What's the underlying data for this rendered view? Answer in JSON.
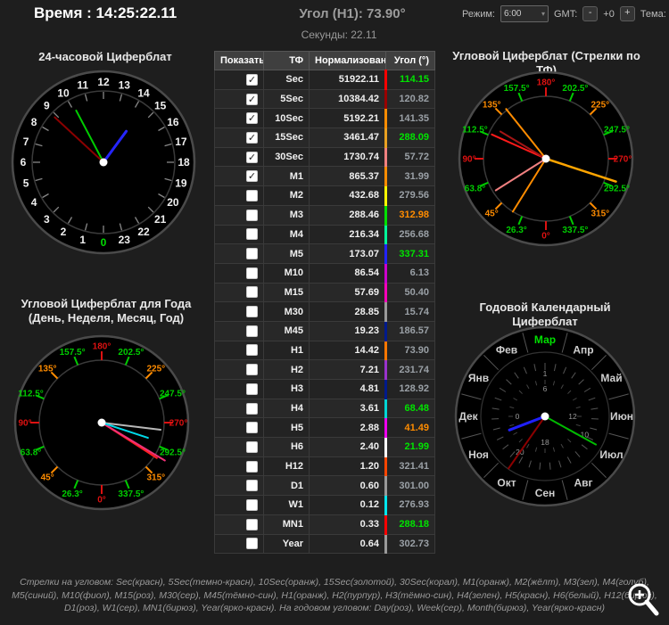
{
  "header": {
    "time_label": "Время : 14:25:22.11",
    "angle_label": "Угол (H1): 73.90°",
    "seconds_label": "Секунды: 22.11",
    "mode_label": "Режим:",
    "mode_value": "6:00",
    "gmt_label": "GMT:",
    "gmt_minus": "-",
    "gmt_offset": "+0",
    "gmt_plus": "+",
    "theme_label": "Тема:"
  },
  "clock24": {
    "title": "24-часовой Циферблат",
    "numbers": [
      {
        "t": "12",
        "phi": 0
      },
      {
        "t": "13",
        "phi": 15
      },
      {
        "t": "14",
        "phi": 30
      },
      {
        "t": "15",
        "phi": 45
      },
      {
        "t": "16",
        "phi": 60
      },
      {
        "t": "17",
        "phi": 75
      },
      {
        "t": "18",
        "phi": 90
      },
      {
        "t": "19",
        "phi": 105
      },
      {
        "t": "20",
        "phi": 120
      },
      {
        "t": "21",
        "phi": 135
      },
      {
        "t": "22",
        "phi": 150
      },
      {
        "t": "23",
        "phi": 165
      },
      {
        "t": "0",
        "phi": 180,
        "color": "#00dd00"
      },
      {
        "t": "1",
        "phi": 195
      },
      {
        "t": "2",
        "phi": 210
      },
      {
        "t": "3",
        "phi": 225
      },
      {
        "t": "4",
        "phi": 240
      },
      {
        "t": "5",
        "phi": 255
      },
      {
        "t": "6",
        "phi": 270
      },
      {
        "t": "7",
        "phi": 285
      },
      {
        "t": "8",
        "phi": 300
      },
      {
        "t": "9",
        "phi": 315
      },
      {
        "t": "10",
        "phi": 330
      },
      {
        "t": "11",
        "phi": 345
      }
    ],
    "hands": [
      {
        "name": "hour",
        "phi": 36.3,
        "len": 0.54,
        "color": "#2525ff",
        "w": 3
      },
      {
        "name": "minute",
        "phi": 332.2,
        "len": 0.82,
        "color": "#00cc00",
        "w": 2
      },
      {
        "name": "second",
        "phi": 312.7,
        "len": 0.93,
        "color": "#8b0000",
        "w": 2
      }
    ]
  },
  "dial_tf": {
    "title": "Угловой Циферблат (Стрелки по ТФ)",
    "labels": [
      {
        "t": "180°",
        "phi": 0,
        "color": "#dd1111"
      },
      {
        "t": "202.5°",
        "phi": 22.5,
        "color": "#00cc00"
      },
      {
        "t": "225°",
        "phi": 45,
        "color": "#ff8c00"
      },
      {
        "t": "247.5°",
        "phi": 67.5,
        "color": "#00cc00"
      },
      {
        "t": "270°",
        "phi": 90,
        "color": "#dd1111"
      },
      {
        "t": "292.5°",
        "phi": 112.5,
        "color": "#00cc00"
      },
      {
        "t": "315°",
        "phi": 135,
        "color": "#ff8c00"
      },
      {
        "t": "337.5°",
        "phi": 157.5,
        "color": "#00cc00"
      },
      {
        "t": "0°",
        "phi": 180,
        "color": "#dd1111"
      },
      {
        "t": "26.3°",
        "phi": 202.5,
        "color": "#00cc00"
      },
      {
        "t": "45°",
        "phi": 225,
        "color": "#ff8c00"
      },
      {
        "t": "63.8°",
        "phi": 247.5,
        "color": "#00cc00"
      },
      {
        "t": "90°",
        "phi": 270,
        "color": "#dd1111"
      },
      {
        "t": "112.5°",
        "phi": 292.5,
        "color": "#00cc00"
      },
      {
        "t": "135°",
        "phi": 315,
        "color": "#ff8c00"
      },
      {
        "t": "157.5°",
        "phi": 337.5,
        "color": "#00cc00"
      }
    ],
    "hands": [
      {
        "name": "Sec",
        "phi": 294.15,
        "len": 0.95,
        "color": "#ff1a1a",
        "w": 2
      },
      {
        "name": "5Sec",
        "phi": 300.82,
        "len": 0.85,
        "color": "#a31515",
        "w": 2
      },
      {
        "name": "10Sec",
        "phi": 321.35,
        "len": 1.02,
        "color": "#ff8c00",
        "w": 2
      },
      {
        "name": "15Sec",
        "phi": 108.09,
        "len": 1.18,
        "color": "#ffa500",
        "w": 2.5
      },
      {
        "name": "30Sec",
        "phi": 237.72,
        "len": 0.95,
        "color": "#f08080",
        "w": 2
      },
      {
        "name": "M1",
        "phi": 211.99,
        "len": 1.0,
        "color": "#ff8c00",
        "w": 2
      }
    ]
  },
  "dial_year": {
    "title": "Угловой Циферблат для Года (День, Неделя, Месяц, Год)",
    "hands": [
      {
        "name": "Year",
        "phi": 122.73,
        "len": 1.05,
        "color": "#ff2020",
        "w": 2
      },
      {
        "name": "Day",
        "phi": 121.0,
        "len": 1.18,
        "color": "#f03078",
        "w": 2
      },
      {
        "name": "Week",
        "phi": 96.93,
        "len": 0.95,
        "color": "#b8b8b8",
        "w": 2
      },
      {
        "name": "Month",
        "phi": 108.18,
        "len": 0.78,
        "color": "#00d8e8",
        "w": 2
      }
    ]
  },
  "calendar": {
    "title": "Годовой Календарный Циферблат",
    "months": [
      {
        "t": "Мар",
        "phi": 0,
        "color": "#00e000"
      },
      {
        "t": "Апр",
        "phi": 30,
        "color": "#cfcfcf"
      },
      {
        "t": "Май",
        "phi": 60,
        "color": "#cfcfcf"
      },
      {
        "t": "Июн",
        "phi": 90,
        "color": "#cfcfcf"
      },
      {
        "t": "Июл",
        "phi": 120,
        "color": "#cfcfcf"
      },
      {
        "t": "Авг",
        "phi": 150,
        "color": "#cfcfcf"
      },
      {
        "t": "Сен",
        "phi": 180,
        "color": "#cfcfcf"
      },
      {
        "t": "Окт",
        "phi": 210,
        "color": "#cfcfcf"
      },
      {
        "t": "Ноя",
        "phi": 240,
        "color": "#cfcfcf"
      },
      {
        "t": "Дек",
        "phi": 270,
        "color": "#cfcfcf"
      },
      {
        "t": "Янв",
        "phi": 300,
        "color": "#cfcfcf"
      },
      {
        "t": "Фев",
        "phi": 330,
        "color": "#cfcfcf"
      }
    ],
    "inner_labels": [
      {
        "t": "1",
        "phi": 0,
        "r": 48
      },
      {
        "t": "6",
        "phi": 0,
        "r": 31
      },
      {
        "t": "12",
        "phi": 90,
        "r": 31
      },
      {
        "t": "10",
        "phi": 115,
        "r": 49
      },
      {
        "t": "18",
        "phi": 180,
        "r": 29
      },
      {
        "t": "20",
        "phi": 215,
        "r": 49
      },
      {
        "t": "0",
        "phi": 270,
        "r": 31
      }
    ],
    "hands": [
      {
        "name": "blue",
        "phi": 249,
        "len": 0.57,
        "color": "#2020ff",
        "w": 3
      },
      {
        "name": "dark-red",
        "phi": 215,
        "len": 0.95,
        "color": "#8b0000",
        "w": 2
      },
      {
        "name": "green",
        "phi": 119,
        "len": 0.87,
        "color": "#00bb00",
        "w": 2
      }
    ]
  },
  "table": {
    "headers": [
      "Показать",
      "ТФ",
      "Нормализованное",
      "Угол (°)"
    ],
    "angle_colors": {
      "green": "#00e400",
      "orange": "#ff8c00",
      "gray": "#9aa0a6"
    },
    "rows": [
      {
        "show": true,
        "tf": "Sec",
        "norm": "51922.11",
        "angle": "114.15",
        "tone": "green",
        "bar": "#ff0000"
      },
      {
        "show": true,
        "tf": "5Sec",
        "norm": "10384.42",
        "angle": "120.82",
        "tone": "gray",
        "bar": "#990000"
      },
      {
        "show": true,
        "tf": "10Sec",
        "norm": "5192.21",
        "angle": "141.35",
        "tone": "gray",
        "bar": "#ff8c00"
      },
      {
        "show": true,
        "tf": "15Sec",
        "norm": "3461.47",
        "angle": "288.09",
        "tone": "green",
        "bar": "#e8a020"
      },
      {
        "show": true,
        "tf": "30Sec",
        "norm": "1730.74",
        "angle": "57.72",
        "tone": "gray",
        "bar": "#f08080"
      },
      {
        "show": true,
        "tf": "M1",
        "norm": "865.37",
        "angle": "31.99",
        "tone": "gray",
        "bar": "#ff8c00"
      },
      {
        "show": false,
        "tf": "M2",
        "norm": "432.68",
        "angle": "279.56",
        "tone": "gray",
        "bar": "#ffff00"
      },
      {
        "show": false,
        "tf": "M3",
        "norm": "288.46",
        "angle": "312.98",
        "tone": "orange",
        "bar": "#00e000"
      },
      {
        "show": false,
        "tf": "M4",
        "norm": "216.34",
        "angle": "256.68",
        "tone": "gray",
        "bar": "#00fa9a"
      },
      {
        "show": false,
        "tf": "M5",
        "norm": "173.07",
        "angle": "337.31",
        "tone": "green",
        "bar": "#2222ff"
      },
      {
        "show": false,
        "tf": "M10",
        "norm": "86.54",
        "angle": "6.13",
        "tone": "gray",
        "bar": "#cc00cc"
      },
      {
        "show": false,
        "tf": "M15",
        "norm": "57.69",
        "angle": "50.40",
        "tone": "gray",
        "bar": "#ff00bb"
      },
      {
        "show": false,
        "tf": "M30",
        "norm": "28.85",
        "angle": "15.74",
        "tone": "gray",
        "bar": "#999999"
      },
      {
        "show": false,
        "tf": "M45",
        "norm": "19.23",
        "angle": "186.57",
        "tone": "gray",
        "bar": "#001a8b"
      },
      {
        "show": false,
        "tf": "H1",
        "norm": "14.42",
        "angle": "73.90",
        "tone": "gray",
        "bar": "#ff7700"
      },
      {
        "show": false,
        "tf": "H2",
        "norm": "7.21",
        "angle": "231.74",
        "tone": "gray",
        "bar": "#9932cc"
      },
      {
        "show": false,
        "tf": "H3",
        "norm": "4.81",
        "angle": "128.92",
        "tone": "gray",
        "bar": "#001a8b"
      },
      {
        "show": false,
        "tf": "H4",
        "norm": "3.61",
        "angle": "68.48",
        "tone": "green",
        "bar": "#00d5d5"
      },
      {
        "show": false,
        "tf": "H5",
        "norm": "2.88",
        "angle": "41.49",
        "tone": "orange",
        "bar": "#ee00ee"
      },
      {
        "show": false,
        "tf": "H6",
        "norm": "2.40",
        "angle": "21.99",
        "tone": "green",
        "bar": "#ffffff"
      },
      {
        "show": false,
        "tf": "H12",
        "norm": "1.20",
        "angle": "321.41",
        "tone": "gray",
        "bar": "#ff4500"
      },
      {
        "show": false,
        "tf": "D1",
        "norm": "0.60",
        "angle": "301.00",
        "tone": "gray",
        "bar": "#999999"
      },
      {
        "show": false,
        "tf": "W1",
        "norm": "0.12",
        "angle": "276.93",
        "tone": "gray",
        "bar": "#00e5ee"
      },
      {
        "show": false,
        "tf": "MN1",
        "norm": "0.33",
        "angle": "288.18",
        "tone": "green",
        "bar": "#ff0000"
      },
      {
        "show": false,
        "tf": "Year",
        "norm": "0.64",
        "angle": "302.73",
        "tone": "gray",
        "bar": "#999999"
      }
    ]
  },
  "footer": {
    "legend": "Стрелки на угловом: Sec(красн), 5Sec(темно-красн), 10Sec(оранж), 15Sec(золотой), 30Sec(корал), M1(оранж), M2(жёлт), M3(зел), M4(голуб), M5(синий), M10(фиол), M15(роз), M30(сер), M45(тёмно-син), H1(оранж), H2(пурпур), H3(тёмно-син), H4(зелен), H5(красн), H6(белый), H12(бирюз), D1(роз), W1(сер), MN1(бирюз), Year(ярко-красн). На годовом угловом: Day(роз), Week(сер), Month(бирюз), Year(ярко-красн)"
  }
}
